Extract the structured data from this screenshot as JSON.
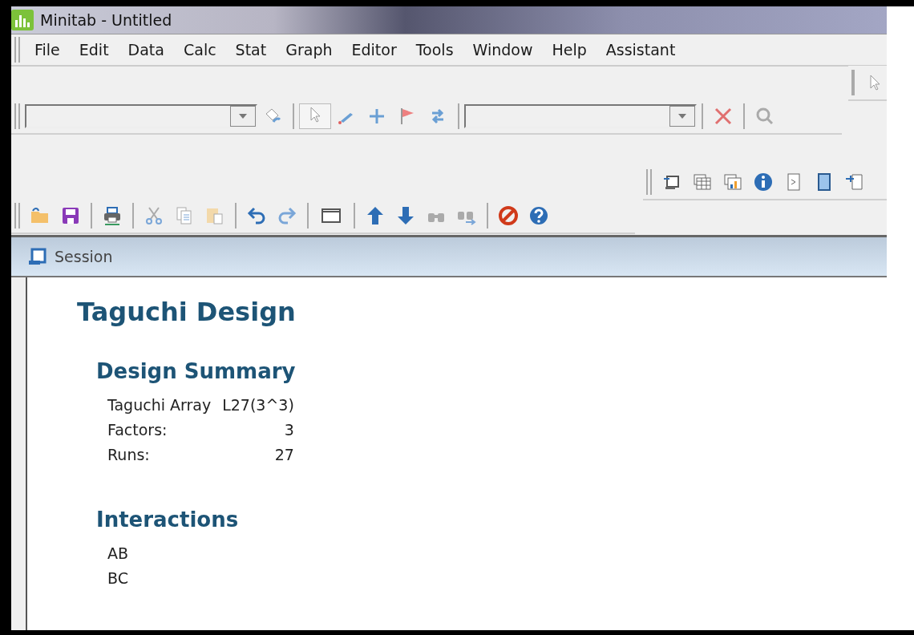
{
  "window": {
    "title": "Minitab - Untitled"
  },
  "menu": [
    "File",
    "Edit",
    "Data",
    "Calc",
    "Stat",
    "Graph",
    "Editor",
    "Tools",
    "Window",
    "Help",
    "Assistant"
  ],
  "session": {
    "title": "Session",
    "heading": "Taguchi Design",
    "sections": [
      {
        "kind": "table",
        "heading": "Design Summary",
        "rows": [
          {
            "label": "Taguchi Array",
            "value": "L27(3^3)"
          },
          {
            "label": "Factors:",
            "value": "3"
          },
          {
            "label": "Runs:",
            "value": "27"
          }
        ]
      },
      {
        "kind": "list",
        "heading": "Interactions",
        "items": [
          "AB",
          "BC"
        ]
      }
    ]
  }
}
